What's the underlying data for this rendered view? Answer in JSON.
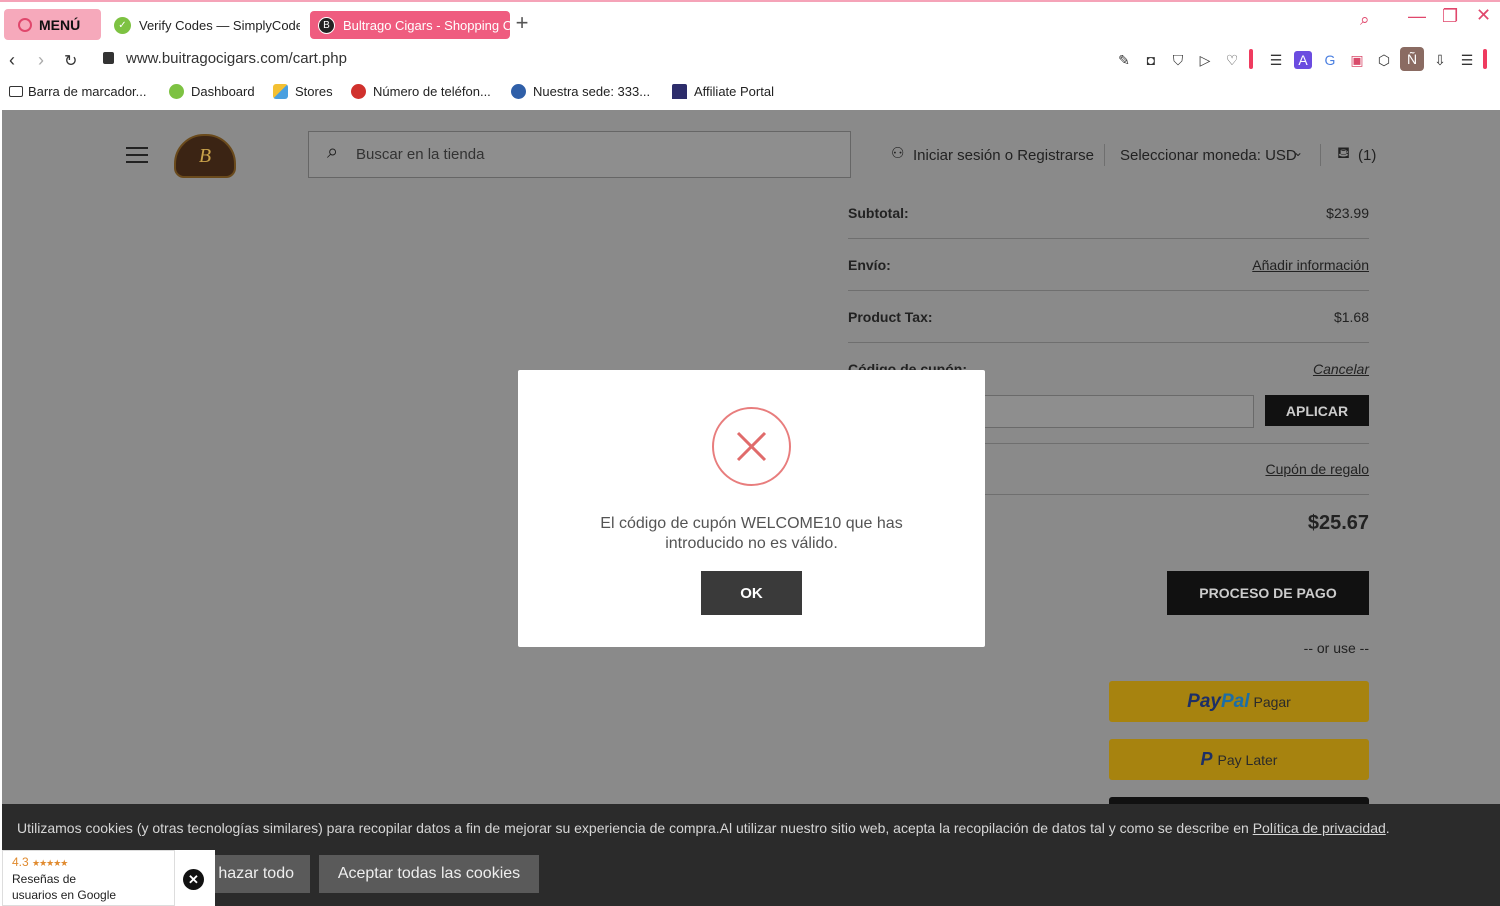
{
  "browser": {
    "menu_label": "MENÚ",
    "tabs": [
      {
        "label": "Verify Codes — SimplyCodes",
        "icon": "simplycodes-icon"
      },
      {
        "label": "Bultrago Cigars - Shopping Cart",
        "icon": "buitrago-icon"
      }
    ],
    "url": "www.buitragocigars.com/cart.php",
    "bookmarks": [
      {
        "label": "Barra de marcador...",
        "icon": "folder-icon"
      },
      {
        "label": "Dashboard",
        "icon": "simplycodes-icon"
      },
      {
        "label": "Stores",
        "icon": "stores-icon"
      },
      {
        "label": "Número de teléfon...",
        "icon": "phone-site-icon"
      },
      {
        "label": "Nuestra sede: 333...",
        "icon": "location-site-icon"
      },
      {
        "label": "Affiliate Portal",
        "icon": "affiliate-icon"
      }
    ]
  },
  "store_header": {
    "search_placeholder": "Buscar en la tienda",
    "login_label": "Iniciar sesión o Registrarse",
    "currency_label": "Seleccionar moneda: USD",
    "cart_label": "(1)"
  },
  "cart_summary": {
    "subtotal_label": "Subtotal:",
    "subtotal_value": "$23.99",
    "shipping_label": "Envío:",
    "shipping_link": "Añadir información",
    "tax_label": "Product Tax:",
    "tax_value": "$1.68",
    "coupon_label": "Código de cupón:",
    "coupon_cancel": "Cancelar",
    "apply_label": "APLICAR",
    "gift_link": "Cupón de regalo",
    "total_value": "$25.67",
    "checkout_label": "PROCESO DE PAGO",
    "or_use": "-- or use --",
    "paypal_label": "Pagar",
    "paylater_label": "Pay Later"
  },
  "modal": {
    "message": "El código de cupón WELCOME10 que has introducido no es válido.",
    "ok_label": "OK"
  },
  "cookie_banner": {
    "text": "Utilizamos cookies (y otras tecnologías similares) para recopilar datos a fin de mejorar su experiencia de compra.Al utilizar nuestro sitio web, acepta la recopilación de datos tal y como se describe en ",
    "policy_link": "Política de privacidad",
    "reject_label": "hazar todo",
    "accept_label": "Aceptar todas las cookies"
  },
  "google_reviews": {
    "rating": "4.3",
    "line1": "Reseñas de",
    "line2": "usuarios en Google"
  },
  "colors": {
    "accent": "#ef5c7f",
    "overlay": "#8a8a8a",
    "paypal": "#a7830f"
  }
}
